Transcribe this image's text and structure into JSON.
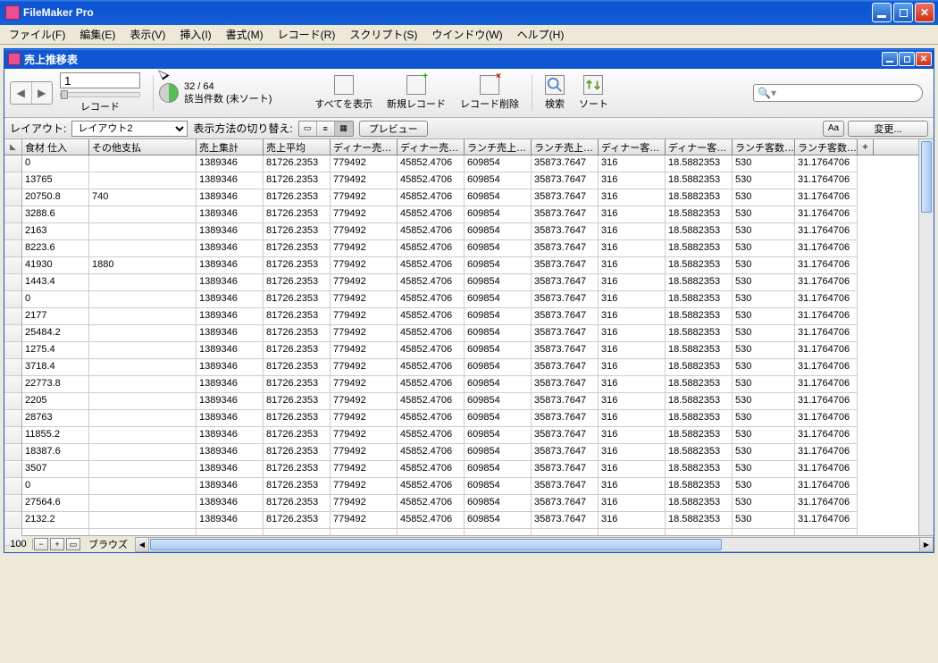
{
  "app": {
    "title": "FileMaker Pro"
  },
  "menu": [
    "ファイル(F)",
    "編集(E)",
    "表示(V)",
    "挿入(I)",
    "書式(M)",
    "レコード(R)",
    "スクリプト(S)",
    "ウインドウ(W)",
    "ヘルプ(H)"
  ],
  "doc": {
    "title": "売上推移表"
  },
  "toolbar": {
    "record_number": "1",
    "record_label": "レコード",
    "pie_top": "32 / 64",
    "pie_bottom": "該当件数 (未ソート)",
    "btn_show_all": "すべてを表示",
    "btn_new_record": "新規レコード",
    "btn_delete_record": "レコード削除",
    "btn_find": "検索",
    "btn_sort": "ソート",
    "search_placeholder": ""
  },
  "layoutbar": {
    "layout_label": "レイアウト:",
    "layout_value": "レイアウト2",
    "switch_label": "表示方法の切り替え:",
    "preview": "プレビュー",
    "aa": "Aa",
    "change": "変更..."
  },
  "columns": [
    {
      "w": 75,
      "label": "食材 仕入"
    },
    {
      "w": 120,
      "label": "その他支払"
    },
    {
      "w": 75,
      "label": "売上集計"
    },
    {
      "w": 75,
      "label": "売上平均"
    },
    {
      "w": 75,
      "label": "ディナー売…"
    },
    {
      "w": 75,
      "label": "ディナー売…"
    },
    {
      "w": 75,
      "label": "ランチ売上…"
    },
    {
      "w": 75,
      "label": "ランチ売上…"
    },
    {
      "w": 75,
      "label": "ディナー客…"
    },
    {
      "w": 75,
      "label": "ディナー客…"
    },
    {
      "w": 70,
      "label": "ランチ客数…"
    },
    {
      "w": 70,
      "label": "ランチ客数…"
    }
  ],
  "add_col": "+",
  "rows": [
    [
      "0",
      "",
      "1389346",
      "81726.2353",
      "779492",
      "45852.4706",
      "609854",
      "35873.7647",
      "316",
      "18.5882353",
      "530",
      "31.1764706"
    ],
    [
      "13765",
      "",
      "1389346",
      "81726.2353",
      "779492",
      "45852.4706",
      "609854",
      "35873.7647",
      "316",
      "18.5882353",
      "530",
      "31.1764706"
    ],
    [
      "20750.8",
      "740",
      "1389346",
      "81726.2353",
      "779492",
      "45852.4706",
      "609854",
      "35873.7647",
      "316",
      "18.5882353",
      "530",
      "31.1764706"
    ],
    [
      "3288.6",
      "",
      "1389346",
      "81726.2353",
      "779492",
      "45852.4706",
      "609854",
      "35873.7647",
      "316",
      "18.5882353",
      "530",
      "31.1764706"
    ],
    [
      "2163",
      "",
      "1389346",
      "81726.2353",
      "779492",
      "45852.4706",
      "609854",
      "35873.7647",
      "316",
      "18.5882353",
      "530",
      "31.1764706"
    ],
    [
      "8223.6",
      "",
      "1389346",
      "81726.2353",
      "779492",
      "45852.4706",
      "609854",
      "35873.7647",
      "316",
      "18.5882353",
      "530",
      "31.1764706"
    ],
    [
      "41930",
      "1880",
      "1389346",
      "81726.2353",
      "779492",
      "45852.4706",
      "609854",
      "35873.7647",
      "316",
      "18.5882353",
      "530",
      "31.1764706"
    ],
    [
      "1443.4",
      "",
      "1389346",
      "81726.2353",
      "779492",
      "45852.4706",
      "609854",
      "35873.7647",
      "316",
      "18.5882353",
      "530",
      "31.1764706"
    ],
    [
      "0",
      "",
      "1389346",
      "81726.2353",
      "779492",
      "45852.4706",
      "609854",
      "35873.7647",
      "316",
      "18.5882353",
      "530",
      "31.1764706"
    ],
    [
      "2177",
      "",
      "1389346",
      "81726.2353",
      "779492",
      "45852.4706",
      "609854",
      "35873.7647",
      "316",
      "18.5882353",
      "530",
      "31.1764706"
    ],
    [
      "25484.2",
      "",
      "1389346",
      "81726.2353",
      "779492",
      "45852.4706",
      "609854",
      "35873.7647",
      "316",
      "18.5882353",
      "530",
      "31.1764706"
    ],
    [
      "1275.4",
      "",
      "1389346",
      "81726.2353",
      "779492",
      "45852.4706",
      "609854",
      "35873.7647",
      "316",
      "18.5882353",
      "530",
      "31.1764706"
    ],
    [
      "3718.4",
      "",
      "1389346",
      "81726.2353",
      "779492",
      "45852.4706",
      "609854",
      "35873.7647",
      "316",
      "18.5882353",
      "530",
      "31.1764706"
    ],
    [
      "22773.8",
      "",
      "1389346",
      "81726.2353",
      "779492",
      "45852.4706",
      "609854",
      "35873.7647",
      "316",
      "18.5882353",
      "530",
      "31.1764706"
    ],
    [
      "2205",
      "",
      "1389346",
      "81726.2353",
      "779492",
      "45852.4706",
      "609854",
      "35873.7647",
      "316",
      "18.5882353",
      "530",
      "31.1764706"
    ],
    [
      "28763",
      "",
      "1389346",
      "81726.2353",
      "779492",
      "45852.4706",
      "609854",
      "35873.7647",
      "316",
      "18.5882353",
      "530",
      "31.1764706"
    ],
    [
      "11855.2",
      "",
      "1389346",
      "81726.2353",
      "779492",
      "45852.4706",
      "609854",
      "35873.7647",
      "316",
      "18.5882353",
      "530",
      "31.1764706"
    ],
    [
      "18387.6",
      "",
      "1389346",
      "81726.2353",
      "779492",
      "45852.4706",
      "609854",
      "35873.7647",
      "316",
      "18.5882353",
      "530",
      "31.1764706"
    ],
    [
      "3507",
      "",
      "1389346",
      "81726.2353",
      "779492",
      "45852.4706",
      "609854",
      "35873.7647",
      "316",
      "18.5882353",
      "530",
      "31.1764706"
    ],
    [
      "0",
      "",
      "1389346",
      "81726.2353",
      "779492",
      "45852.4706",
      "609854",
      "35873.7647",
      "316",
      "18.5882353",
      "530",
      "31.1764706"
    ],
    [
      "27564.6",
      "",
      "1389346",
      "81726.2353",
      "779492",
      "45852.4706",
      "609854",
      "35873.7647",
      "316",
      "18.5882353",
      "530",
      "31.1764706"
    ],
    [
      "2132.2",
      "",
      "1389346",
      "81726.2353",
      "779492",
      "45852.4706",
      "609854",
      "35873.7647",
      "316",
      "18.5882353",
      "530",
      "31.1764706"
    ],
    [
      "",
      "",
      "",
      "",
      "",
      "",
      "",
      "",
      "",
      "",
      "",
      ""
    ]
  ],
  "status": {
    "zoom": "100",
    "mode": "ブラウズ"
  }
}
